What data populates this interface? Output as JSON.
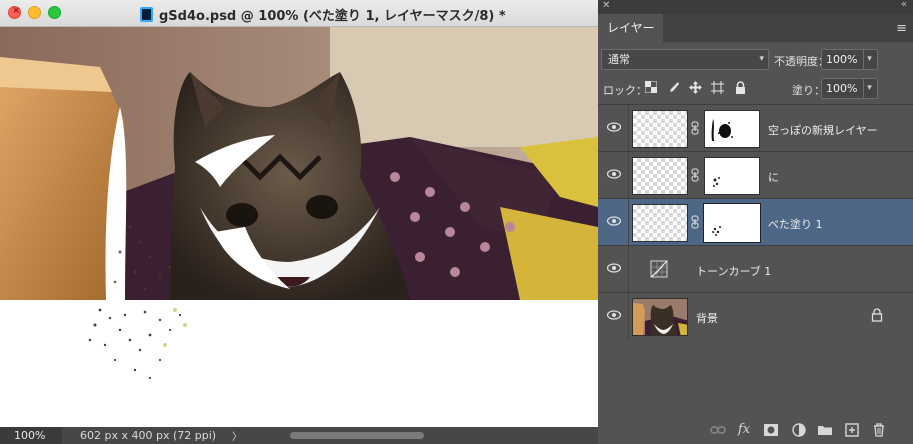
{
  "window": {
    "title": "gSd4o.psd @ 100% (べた塗り 1, レイヤーマスク/8) *",
    "close_symbol": "×"
  },
  "status": {
    "zoom": "100%",
    "doc_size": "602 px x 400 px (72 ppi)",
    "arrow": "〉"
  },
  "panel": {
    "tab": "レイヤー",
    "blend_mode": "通常",
    "opacity_label": "不透明度：",
    "opacity_value": "100%",
    "lock_label": "ロック：",
    "fill_label": "塗り：",
    "fill_value": "100%",
    "menu_icon": "hamburger-menu-icon"
  },
  "layers": [
    {
      "name": "空っぽの新規レイヤー",
      "type": "mask-layer",
      "selected": false
    },
    {
      "name": "に",
      "type": "mask-layer",
      "selected": false
    },
    {
      "name": "べた塗り 1",
      "type": "mask-layer",
      "selected": true
    },
    {
      "name": "トーンカーブ 1",
      "type": "adjustment",
      "selected": false
    },
    {
      "name": "背景",
      "type": "background",
      "selected": false,
      "locked": true
    }
  ],
  "bottom_icons": [
    "link-icon",
    "fx-icon",
    "mask-icon",
    "adjustment-icon",
    "folder-icon",
    "new-layer-icon",
    "trash-icon"
  ],
  "bottom_fx": "fx",
  "colors": {
    "panel_bg": "#535353",
    "selected_layer": "#4f6786",
    "traffic_close": "#fe5f57",
    "traffic_min": "#febc2e",
    "traffic_max": "#28c840"
  }
}
